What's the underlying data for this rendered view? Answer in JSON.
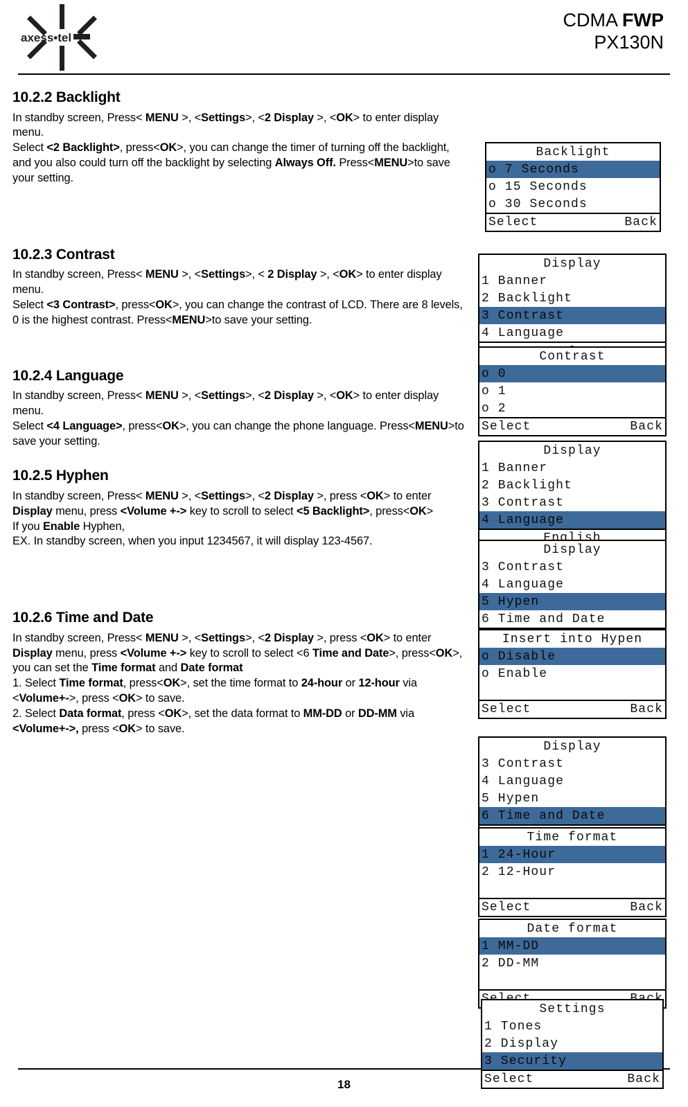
{
  "header": {
    "logo_text": "axess•tel",
    "title_line1_light": "CDMA ",
    "title_line1_bold": "FWP",
    "title_line2": "PX130N"
  },
  "sections": [
    {
      "heading": "10.2.2 Backlight",
      "paragraphs": [
        "In standby screen, Press< <b>MENU</b> >, <<b>Settings</b>>, <<b>2 Display</b> >, <<b>OK</b>> to enter display menu.<br>Select <b>&lt;2 Backlight&gt;</b>, press&lt;<b>OK</b>&gt;, you can change the timer of turning off the backlight, and you also could turn off the backlight by selecting <b>Always Off.</b> Press&lt;<b>MENU</b>&gt;to save your setting."
      ]
    },
    {
      "heading": "10.2.3 Contrast",
      "paragraphs": [
        "In standby screen, Press&lt; <b>MENU</b> &gt;, &lt;<b>Settings</b>&gt;, &lt; <b>2 Display</b> &gt;, &lt;<b>OK</b>&gt; to enter display menu.<br>Select <b>&lt;3 Contrast&gt;</b>, press&lt;<b>OK</b>&gt;, you can change the contrast of LCD. There are 8 levels, 0 is the highest contrast. Press&lt;<b>MENU</b>&gt;to save your setting."
      ]
    },
    {
      "heading": "10.2.4 Language",
      "paragraphs": [
        "In standby screen, Press&lt; <b>MENU</b> &gt;, &lt;<b>Settings</b>&gt;, &lt;<b>2 Display</b> &gt;, &lt;<b>OK</b>&gt; to enter display menu.<br>Select <b>&lt;4 Language&gt;</b>, press&lt;<b>OK</b>&gt;, you can change the phone language. Press&lt;<b>MENU</b>&gt;to save your setting."
      ]
    },
    {
      "heading": "10.2.5 Hyphen",
      "paragraphs": [
        "In standby screen, Press&lt; <b>MENU</b> &gt;, &lt;<b>Settings</b>&gt;, &lt;<b>2 Display</b> &gt;, press &lt;<b>OK</b>&gt; to enter <b>Display</b> menu, press <b>&lt;Volume +-&gt;</b> key to scroll to select <b>&lt;5 Backlight&gt;</b>, press&lt;<b>OK</b>&gt;<br>If you <b>Enable</b> Hyphen,<br>EX. In standby screen, when you input 1234567, it will display 123-4567."
      ]
    },
    {
      "heading": "10.2.6 Time and Date",
      "paragraphs": [
        "In standby screen, Press&lt; <b>MENU</b> &gt;, &lt;<b>Settings</b>&gt;, &lt;<b>2 Display</b> &gt;, press &lt;<b>OK</b>&gt; to enter <b>Display</b> menu, press <b>&lt;Volume +-&gt;</b> key to scroll to select &lt;6 <b>Time and Date</b>&gt;, press&lt;<b>OK</b>&gt;, you can set the <b>Time format</b> and <b>Date format</b><br>1. Select <b>Time format</b>, press&lt;<b>OK</b>&gt;, set the time format to <b>24-hour</b> or <b>12-hour</b> via &lt;<b>Volume+-</b>&gt;, press &lt;<b>OK</b>&gt; to save.<br>2. Select <b>Data format</b>, press &lt;<b>OK</b>&gt;, set the data format to <b>MM-DD</b> or <b>DD-MM</b> via <b>&lt;Volume+-&gt;,</b> press &lt;<b>OK</b>&gt; to save."
      ]
    }
  ],
  "lcd_panels": {
    "backlight": {
      "title": "Backlight",
      "items": [
        "o 7 Seconds",
        "o 15 Seconds",
        "o 30 Seconds"
      ],
      "selected_index": 0,
      "softkey_left": "Select",
      "softkey_right": "Back"
    },
    "display_contrast": {
      "title": "Display",
      "items": [
        "1 Banner",
        "2 Backlight",
        "3 Contrast",
        "4 Language"
      ],
      "selected_index": 2,
      "value": "2"
    },
    "contrast": {
      "title": "Contrast",
      "items": [
        "o 0",
        "o 1",
        "o 2"
      ],
      "selected_index": 0,
      "softkey_left": "Select",
      "softkey_right": "Back"
    },
    "display_language": {
      "title": "Display",
      "items": [
        "1 Banner",
        "2 Backlight",
        "3 Contrast",
        "4 Language"
      ],
      "selected_index": 3,
      "value": "English"
    },
    "display_hyphen": {
      "title": "Display",
      "items": [
        "3 Contrast",
        "4 Language",
        "5 Hypen",
        "6 Time and Date"
      ],
      "selected_index": 2,
      "value": "Enable"
    },
    "insert_hyphen": {
      "title": "Insert into Hypen",
      "items": [
        "o Disable",
        "o Enable"
      ],
      "selected_index": 0,
      "softkey_left": "Select",
      "softkey_right": "Back"
    },
    "display_time": {
      "title": "Display",
      "items": [
        "3 Contrast",
        "4 Language",
        "5 Hypen",
        "6 Time and Date"
      ],
      "selected_index": 3,
      "value": "..."
    },
    "time_format": {
      "title": "Time format",
      "items": [
        "1 24-Hour",
        "2 12-Hour"
      ],
      "selected_index": 0,
      "softkey_left": "Select",
      "softkey_right": "Back"
    },
    "date_format": {
      "title": "Date format",
      "items": [
        "1 MM-DD",
        "2 DD-MM"
      ],
      "selected_index": 0,
      "softkey_left": "Select",
      "softkey_right": "Back"
    },
    "settings": {
      "title": "Settings",
      "items": [
        "1 Tones",
        "2 Display",
        "3 Security"
      ],
      "selected_index": 2,
      "softkey_left": "Select",
      "softkey_right": "Back"
    }
  },
  "footer": {
    "page_number": "18"
  },
  "colors": {
    "highlight": "#3d6A99",
    "text": "#000000",
    "background": "#ffffff"
  }
}
